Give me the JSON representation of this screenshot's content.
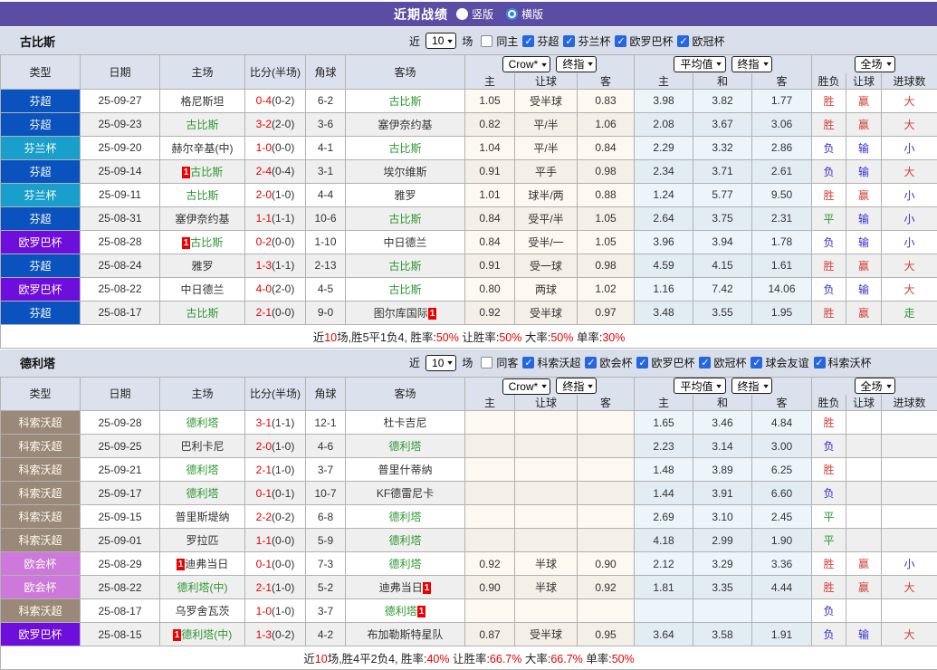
{
  "title_bar": {
    "title": "近期战绩",
    "radios": [
      {
        "label": "竖版",
        "checked": false
      },
      {
        "label": "横版",
        "checked": true
      }
    ]
  },
  "table_header": {
    "left_cols": [
      "类型",
      "日期",
      "主场",
      "比分(半场)",
      "角球",
      "客场"
    ],
    "asia_cols": [
      "主",
      "让球",
      "客"
    ],
    "avg_cols": [
      "主",
      "和",
      "客"
    ],
    "result_cols": [
      "胜负",
      "让球",
      "进球数"
    ],
    "selects": {
      "asia_source": "Crow*",
      "asia_time": "终指",
      "avg_source": "平均值",
      "avg_time": "终指",
      "result_scope": "全场"
    }
  },
  "colors": {
    "titlebar_bg": "#5a4da3",
    "section_bar_bg": "#d9dfea",
    "header_bg": "#dce2ed",
    "badge_bg": "#ee0000",
    "team_highlight": "#2e9732",
    "score_red": "#e60000",
    "league": {
      "芬超": "#0a53be",
      "芬兰杯": "#189fcb",
      "欧罗巴杯": "#6e0edc",
      "科索沃超": "#9a8878",
      "欧会杯": "#cc79db"
    },
    "verdict_map": {
      "胜": "r",
      "负": "b",
      "平": "g",
      "赢": "r",
      "输": "b",
      "大": "r",
      "小": "b",
      "走": "g"
    }
  },
  "sections": [
    {
      "team": "古比斯",
      "filter": {
        "prefix": "近",
        "rounds": "10",
        "suffix": "场",
        "same": {
          "label": "同主",
          "checked": false
        },
        "leagues": [
          {
            "label": "芬超",
            "checked": true
          },
          {
            "label": "芬兰杯",
            "checked": true
          },
          {
            "label": "欧罗巴杯",
            "checked": true
          },
          {
            "label": "欧冠杯",
            "checked": true
          }
        ]
      },
      "rows": [
        {
          "league": "芬超",
          "date": "25-09-27",
          "home": {
            "name": "格尼斯坦"
          },
          "score": "0-4",
          "half": "(0-2)",
          "corner": "6-2",
          "away": {
            "name": "古比斯",
            "green": true
          },
          "asia": [
            "1.05",
            "受半球",
            "0.83"
          ],
          "avg": [
            "3.98",
            "3.82",
            "1.77"
          ],
          "verdict": [
            "胜",
            "赢",
            "大"
          ]
        },
        {
          "league": "芬超",
          "date": "25-09-23",
          "home": {
            "name": "古比斯",
            "green": true
          },
          "score": "3-2",
          "half": "(2-0)",
          "corner": "3-6",
          "away": {
            "name": "塞伊奈约基"
          },
          "asia": [
            "0.82",
            "平/半",
            "1.06"
          ],
          "avg": [
            "2.08",
            "3.67",
            "3.06"
          ],
          "verdict": [
            "胜",
            "赢",
            "大"
          ]
        },
        {
          "league": "芬兰杯",
          "date": "25-09-20",
          "home": {
            "name": "赫尔辛基(中)"
          },
          "score": "1-0",
          "half": "(0-0)",
          "corner": "4-1",
          "away": {
            "name": "古比斯",
            "green": true
          },
          "asia": [
            "1.04",
            "平/半",
            "0.84"
          ],
          "avg": [
            "2.29",
            "3.32",
            "2.86"
          ],
          "verdict": [
            "负",
            "输",
            "小"
          ]
        },
        {
          "league": "芬超",
          "date": "25-09-14",
          "home": {
            "name": "古比斯",
            "green": true,
            "badge": "pre"
          },
          "score": "2-4",
          "half": "(0-4)",
          "corner": "3-1",
          "away": {
            "name": "埃尔维斯"
          },
          "asia": [
            "0.91",
            "平手",
            "0.98"
          ],
          "avg": [
            "2.34",
            "3.71",
            "2.61"
          ],
          "verdict": [
            "负",
            "输",
            "大"
          ]
        },
        {
          "league": "芬兰杯",
          "date": "25-09-11",
          "home": {
            "name": "古比斯",
            "green": true
          },
          "score": "2-0",
          "half": "(1-0)",
          "corner": "4-4",
          "away": {
            "name": "雅罗"
          },
          "asia": [
            "1.01",
            "球半/两",
            "0.88"
          ],
          "avg": [
            "1.24",
            "5.77",
            "9.50"
          ],
          "verdict": [
            "胜",
            "赢",
            "小"
          ]
        },
        {
          "league": "芬超",
          "date": "25-08-31",
          "home": {
            "name": "塞伊奈约基"
          },
          "score": "1-1",
          "half": "(1-1)",
          "corner": "10-6",
          "away": {
            "name": "古比斯",
            "green": true
          },
          "asia": [
            "0.84",
            "受平/半",
            "1.05"
          ],
          "avg": [
            "2.64",
            "3.75",
            "2.31"
          ],
          "verdict": [
            "平",
            "输",
            "小"
          ]
        },
        {
          "league": "欧罗巴杯",
          "date": "25-08-28",
          "home": {
            "name": "古比斯",
            "green": true,
            "badge": "pre"
          },
          "score": "0-2",
          "half": "(0-0)",
          "corner": "1-10",
          "away": {
            "name": "中日德兰"
          },
          "asia": [
            "0.84",
            "受半/一",
            "1.05"
          ],
          "avg": [
            "3.96",
            "3.94",
            "1.78"
          ],
          "verdict": [
            "负",
            "输",
            "小"
          ]
        },
        {
          "league": "芬超",
          "date": "25-08-24",
          "home": {
            "name": "雅罗"
          },
          "score": "1-3",
          "half": "(1-1)",
          "corner": "2-13",
          "away": {
            "name": "古比斯",
            "green": true
          },
          "asia": [
            "0.91",
            "受一球",
            "0.98"
          ],
          "avg": [
            "4.59",
            "4.15",
            "1.61"
          ],
          "verdict": [
            "胜",
            "赢",
            "大"
          ]
        },
        {
          "league": "欧罗巴杯",
          "date": "25-08-22",
          "home": {
            "name": "中日德兰"
          },
          "score": "4-0",
          "half": "(2-0)",
          "corner": "4-5",
          "away": {
            "name": "古比斯",
            "green": true
          },
          "asia": [
            "0.80",
            "两球",
            "1.02"
          ],
          "avg": [
            "1.16",
            "7.42",
            "14.06"
          ],
          "verdict": [
            "负",
            "输",
            "大"
          ]
        },
        {
          "league": "芬超",
          "date": "25-08-17",
          "home": {
            "name": "古比斯",
            "green": true
          },
          "score": "2-1",
          "half": "(0-0)",
          "corner": "9-0",
          "away": {
            "name": "图尔库国际",
            "badge": "post"
          },
          "asia": [
            "0.92",
            "受半球",
            "0.97"
          ],
          "avg": [
            "3.48",
            "3.55",
            "1.95"
          ],
          "verdict": [
            "胜",
            "赢",
            "走"
          ]
        }
      ],
      "summary": [
        [
          "近",
          "k"
        ],
        [
          "10",
          "r"
        ],
        [
          "场,胜5平1负4, 胜率:",
          "k"
        ],
        [
          "50%",
          "r"
        ],
        [
          " 让胜率:",
          "k"
        ],
        [
          "50%",
          "r"
        ],
        [
          " 大率:",
          "k"
        ],
        [
          "50%",
          "r"
        ],
        [
          " 单率:",
          "k"
        ],
        [
          "30%",
          "r"
        ]
      ]
    },
    {
      "team": "德利塔",
      "filter": {
        "prefix": "近",
        "rounds": "10",
        "suffix": "场",
        "same": {
          "label": "同客",
          "checked": false
        },
        "leagues": [
          {
            "label": "科索沃超",
            "checked": true
          },
          {
            "label": "欧会杯",
            "checked": true
          },
          {
            "label": "欧罗巴杯",
            "checked": true
          },
          {
            "label": "欧冠杯",
            "checked": true
          },
          {
            "label": "球会友谊",
            "checked": true
          },
          {
            "label": "科索沃杯",
            "checked": true
          }
        ]
      },
      "rows": [
        {
          "league": "科索沃超",
          "date": "25-09-28",
          "home": {
            "name": "德利塔",
            "green": true
          },
          "score": "3-1",
          "half": "(1-1)",
          "corner": "12-1",
          "away": {
            "name": "杜卡吉尼"
          },
          "asia": [
            "",
            "",
            ""
          ],
          "avg": [
            "1.65",
            "3.46",
            "4.84"
          ],
          "verdict": [
            "胜",
            "",
            ""
          ]
        },
        {
          "league": "科索沃超",
          "date": "25-09-25",
          "home": {
            "name": "巴利卡尼"
          },
          "score": "2-0",
          "half": "(1-0)",
          "corner": "4-6",
          "away": {
            "name": "德利塔",
            "green": true
          },
          "asia": [
            "",
            "",
            ""
          ],
          "avg": [
            "2.23",
            "3.14",
            "3.00"
          ],
          "verdict": [
            "负",
            "",
            ""
          ]
        },
        {
          "league": "科索沃超",
          "date": "25-09-21",
          "home": {
            "name": "德利塔",
            "green": true
          },
          "score": "2-1",
          "half": "(1-0)",
          "corner": "3-7",
          "away": {
            "name": "普里什蒂纳"
          },
          "asia": [
            "",
            "",
            ""
          ],
          "avg": [
            "1.48",
            "3.89",
            "6.25"
          ],
          "verdict": [
            "胜",
            "",
            ""
          ]
        },
        {
          "league": "科索沃超",
          "date": "25-09-17",
          "home": {
            "name": "德利塔",
            "green": true
          },
          "score": "0-1",
          "half": "(0-1)",
          "corner": "10-7",
          "away": {
            "name": "KF德雷尼卡"
          },
          "asia": [
            "",
            "",
            ""
          ],
          "avg": [
            "1.44",
            "3.91",
            "6.60"
          ],
          "verdict": [
            "负",
            "",
            ""
          ]
        },
        {
          "league": "科索沃超",
          "date": "25-09-15",
          "home": {
            "name": "普里斯堤纳"
          },
          "score": "2-2",
          "half": "(0-2)",
          "corner": "6-8",
          "away": {
            "name": "德利塔",
            "green": true
          },
          "asia": [
            "",
            "",
            ""
          ],
          "avg": [
            "2.69",
            "3.10",
            "2.45"
          ],
          "verdict": [
            "平",
            "",
            ""
          ]
        },
        {
          "league": "科索沃超",
          "date": "25-09-01",
          "home": {
            "name": "罗拉匹"
          },
          "score": "1-1",
          "half": "(0-0)",
          "corner": "5-9",
          "away": {
            "name": "德利塔",
            "green": true
          },
          "asia": [
            "",
            "",
            ""
          ],
          "avg": [
            "4.18",
            "2.99",
            "1.90"
          ],
          "verdict": [
            "平",
            "",
            ""
          ]
        },
        {
          "league": "欧会杯",
          "date": "25-08-29",
          "home": {
            "name": "迪弗当日",
            "badge": "pre"
          },
          "score": "0-1",
          "half": "(0-0)",
          "corner": "7-3",
          "away": {
            "name": "德利塔",
            "green": true
          },
          "asia": [
            "0.92",
            "半球",
            "0.90"
          ],
          "avg": [
            "2.12",
            "3.29",
            "3.36"
          ],
          "verdict": [
            "胜",
            "赢",
            "小"
          ]
        },
        {
          "league": "欧会杯",
          "date": "25-08-22",
          "home": {
            "name": "德利塔(中)",
            "green": true
          },
          "score": "2-1",
          "half": "(1-0)",
          "corner": "5-2",
          "away": {
            "name": "迪弗当日",
            "badge": "post"
          },
          "asia": [
            "0.90",
            "半球",
            "0.92"
          ],
          "avg": [
            "1.81",
            "3.35",
            "4.44"
          ],
          "verdict": [
            "胜",
            "赢",
            "大"
          ]
        },
        {
          "league": "科索沃超",
          "date": "25-08-17",
          "home": {
            "name": "乌罗舍瓦茨"
          },
          "score": "1-0",
          "half": "(1-0)",
          "corner": "3-7",
          "away": {
            "name": "德利塔",
            "green": true,
            "badge": "post"
          },
          "asia": [
            "",
            "",
            ""
          ],
          "avg": [
            "",
            "",
            ""
          ],
          "verdict": [
            "负",
            "",
            ""
          ]
        },
        {
          "league": "欧罗巴杯",
          "date": "25-08-15",
          "home": {
            "name": "德利塔(中)",
            "green": true,
            "badge": "pre"
          },
          "score": "1-3",
          "half": "(0-2)",
          "corner": "4-2",
          "away": {
            "name": "布加勒斯特星队"
          },
          "asia": [
            "0.87",
            "受半球",
            "0.95"
          ],
          "avg": [
            "3.64",
            "3.58",
            "1.91"
          ],
          "verdict": [
            "负",
            "输",
            "大"
          ]
        }
      ],
      "summary": [
        [
          "近",
          "k"
        ],
        [
          "10",
          "r"
        ],
        [
          "场,胜4平2负4, 胜率:",
          "k"
        ],
        [
          "40%",
          "r"
        ],
        [
          " 让胜率:",
          "k"
        ],
        [
          "66.7%",
          "r"
        ],
        [
          " 大率:",
          "k"
        ],
        [
          "66.7%",
          "r"
        ],
        [
          " 单率:",
          "k"
        ],
        [
          "50%",
          "r"
        ]
      ]
    }
  ]
}
